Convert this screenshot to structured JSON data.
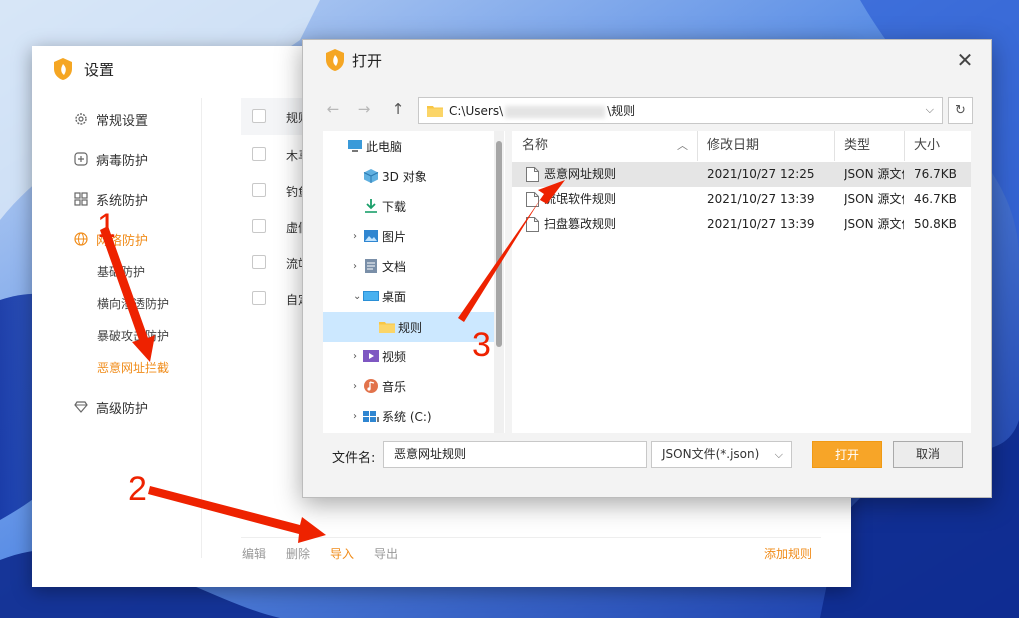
{
  "colors": {
    "accent": "#f08c1a",
    "open_button": "#f7a528",
    "annotation": "#ee2200",
    "wallpaper": "#1a3ea8"
  },
  "settings_window": {
    "title": "设置",
    "nav": [
      {
        "label": "常规设置",
        "icon": "gear-icon",
        "active": false
      },
      {
        "label": "病毒防护",
        "icon": "plus-box-icon",
        "active": false
      },
      {
        "label": "系统防护",
        "icon": "grid-icon",
        "active": false
      },
      {
        "label": "网络防护",
        "icon": "globe-icon",
        "active": true
      },
      {
        "label": "高级防护",
        "icon": "diamond-icon",
        "active": false
      }
    ],
    "sub_nav": [
      {
        "label": "基础防护",
        "active": false
      },
      {
        "label": "横向渗透防护",
        "active": false
      },
      {
        "label": "暴破攻击防护",
        "active": false
      },
      {
        "label": "恶意网址拦截",
        "active": true
      }
    ],
    "rules_header": "规则",
    "rules": [
      "木马",
      "钓鱼",
      "虚假",
      "流氓",
      "自定"
    ],
    "bottom": {
      "edit": "编辑",
      "delete": "删除",
      "import": "导入",
      "export": "导出",
      "add_rule": "添加规则"
    }
  },
  "open_dialog": {
    "title": "打开",
    "address": {
      "prefix": "C:\\Users\\",
      "suffix": "\\规则"
    },
    "tree": [
      {
        "label": "此电脑",
        "icon": "computer-icon"
      },
      {
        "label": "3D 对象",
        "icon": "cube-icon"
      },
      {
        "label": "下载",
        "icon": "download-icon"
      },
      {
        "label": "图片",
        "icon": "picture-icon"
      },
      {
        "label": "文档",
        "icon": "document-icon"
      },
      {
        "label": "桌面",
        "icon": "desktop-icon"
      },
      {
        "label": "规则",
        "icon": "folder-icon"
      },
      {
        "label": "视频",
        "icon": "video-icon"
      },
      {
        "label": "音乐",
        "icon": "music-icon"
      },
      {
        "label": "系统 (C:)",
        "icon": "drive-icon"
      }
    ],
    "columns": [
      "名称",
      "修改日期",
      "类型",
      "大小"
    ],
    "files": [
      {
        "name": "恶意网址规则",
        "date": "2021/10/27 12:25",
        "type": "JSON 源文件",
        "size": "76.7KB",
        "selected": true
      },
      {
        "name": "流氓软件规则",
        "date": "2021/10/27 13:39",
        "type": "JSON 源文件",
        "size": "46.7KB",
        "selected": false
      },
      {
        "name": "扫盘篡改规则",
        "date": "2021/10/27 13:39",
        "type": "JSON 源文件",
        "size": "50.8KB",
        "selected": false
      }
    ],
    "filename_label": "文件名:",
    "filename_value": "恶意网址规则",
    "filetype": "JSON文件(*.json)",
    "open_button": "打开",
    "cancel_button": "取消"
  },
  "annotations": [
    "1",
    "2",
    "3"
  ]
}
